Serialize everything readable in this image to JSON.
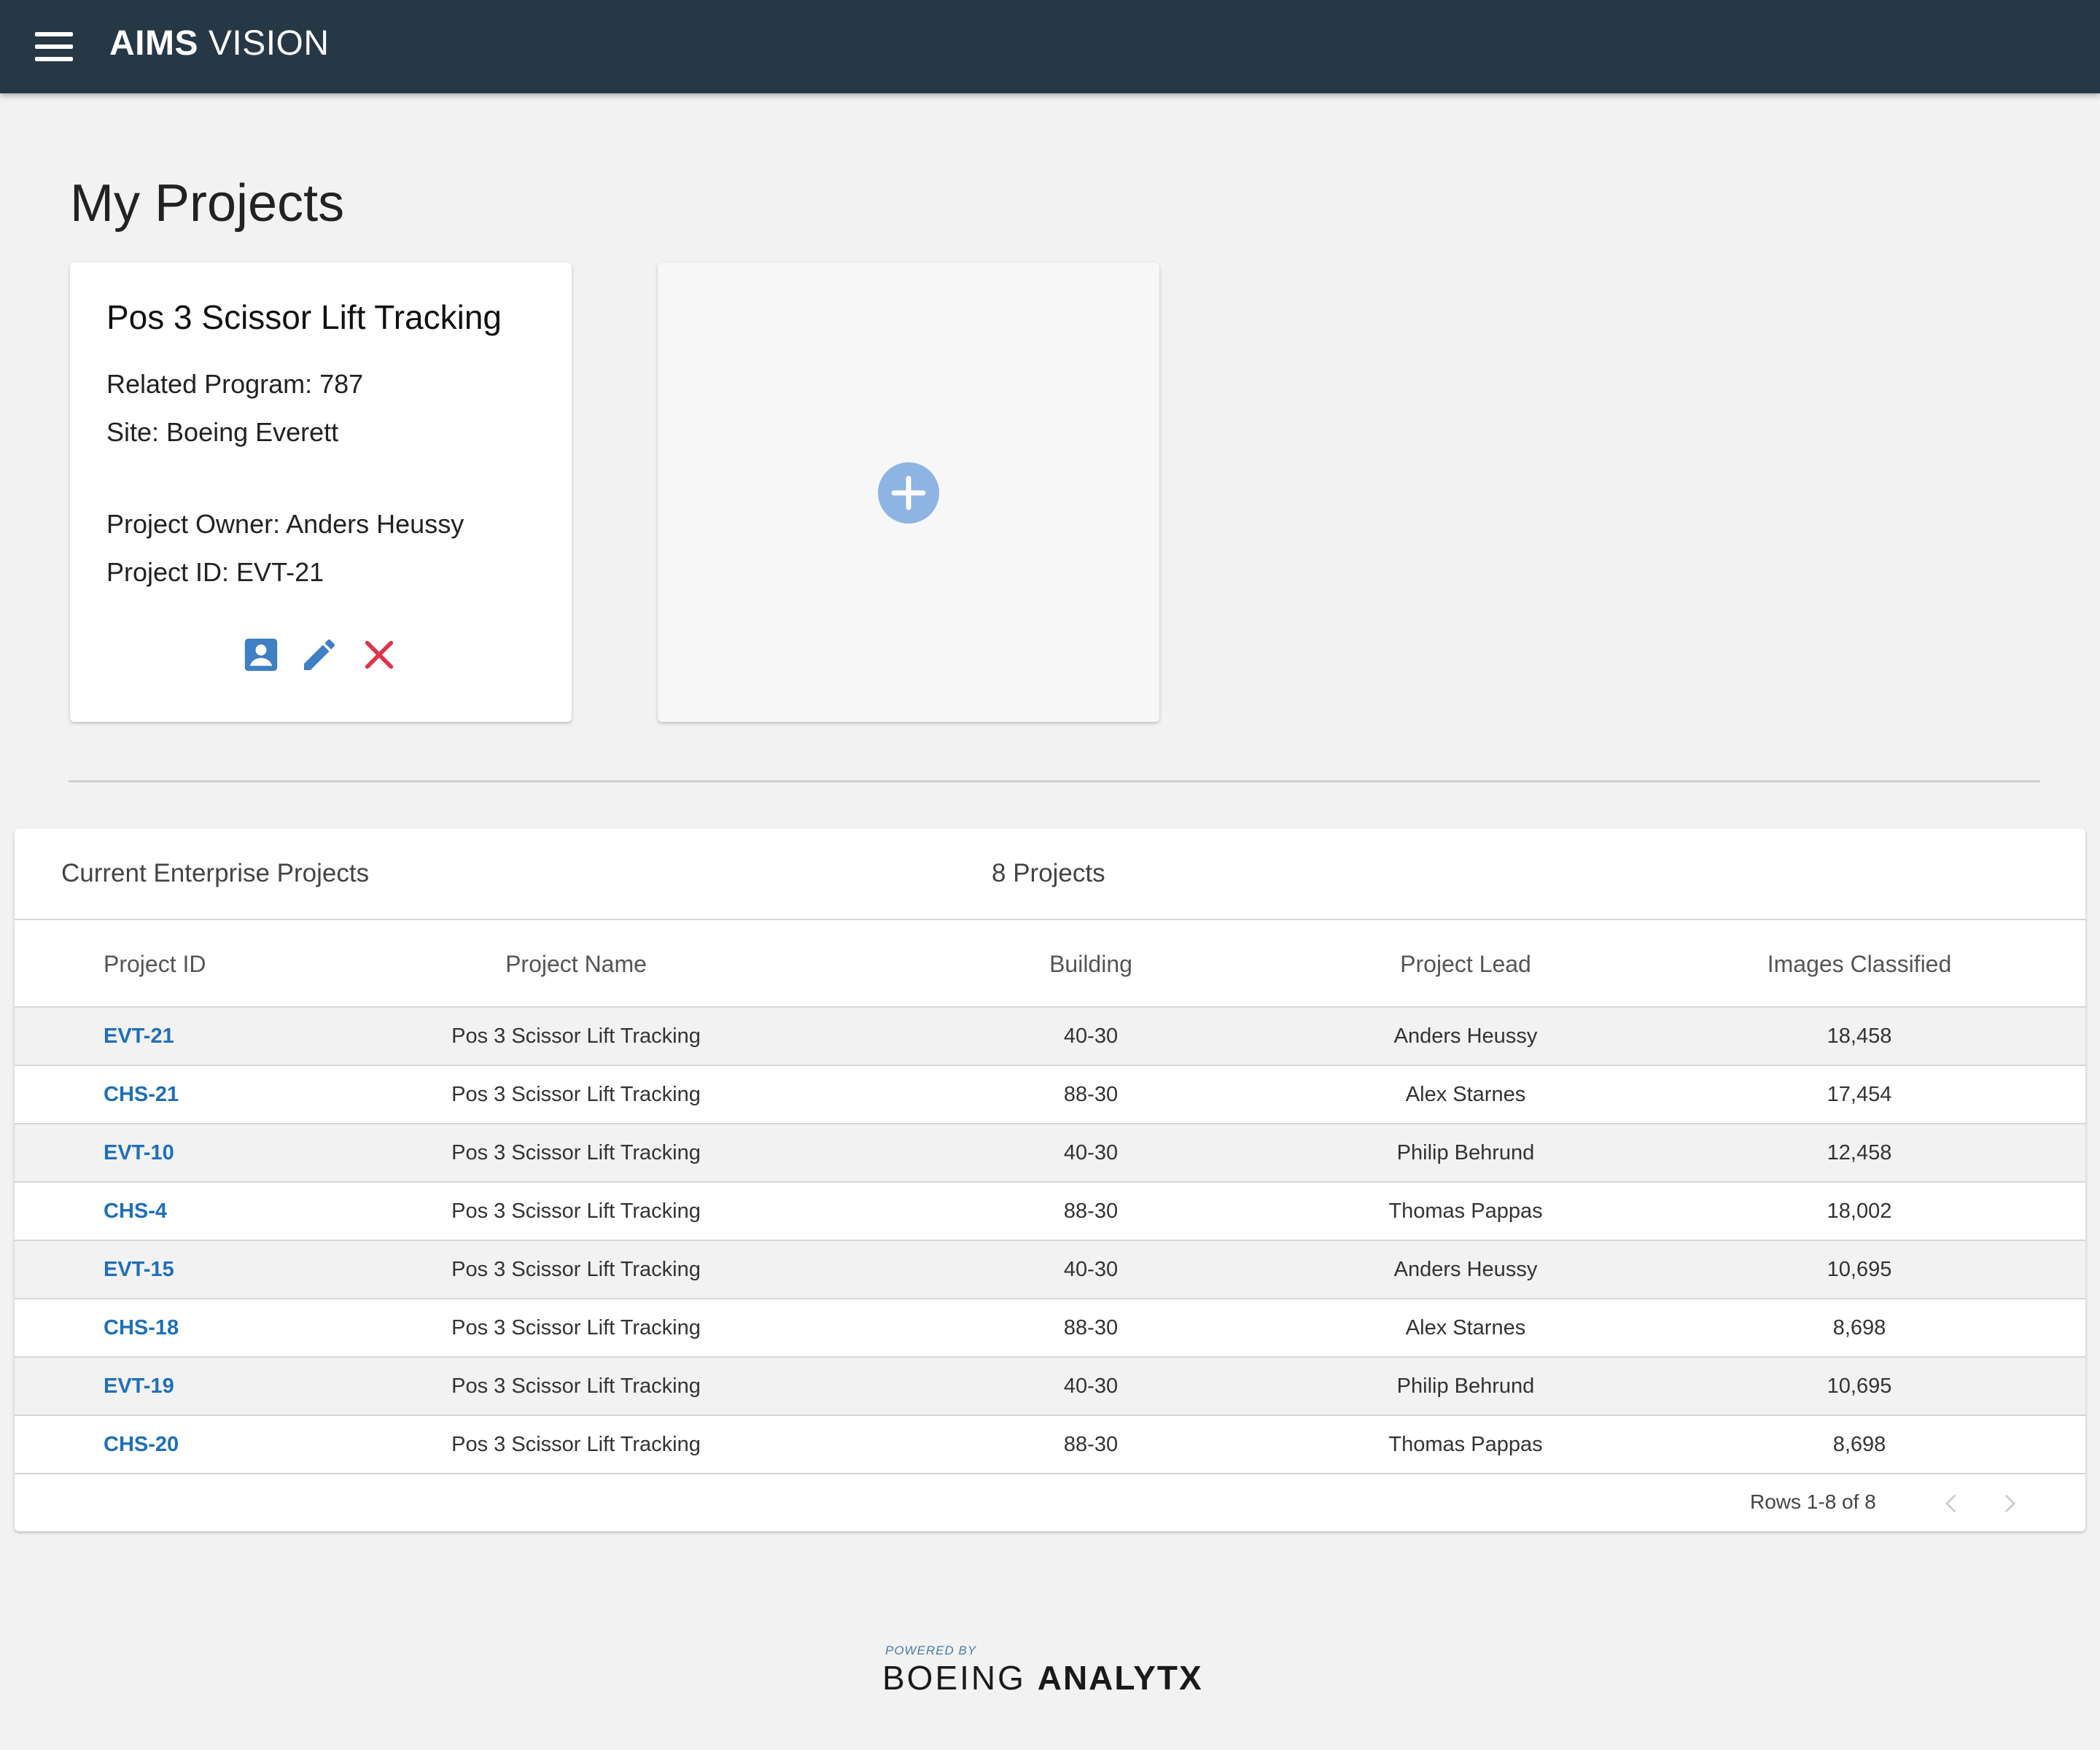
{
  "appbar": {
    "brand_bold": "AIMS",
    "brand_light": "VISION"
  },
  "page": {
    "title": "My Projects"
  },
  "project_card": {
    "title": "Pos 3 Scissor Lift Tracking",
    "related_program": "Related Program: 787",
    "site": "Site: Boeing Everett",
    "owner": "Project Owner: Anders Heussy",
    "project_id": "Project ID: EVT-21",
    "actions": [
      "account-box-icon",
      "pencil-icon",
      "close-icon"
    ],
    "colors": {
      "icon_blue": "#3f7fc4",
      "delete_red": "#e0324a"
    }
  },
  "add_card": {
    "icon": "plus-icon",
    "colors": {
      "circle": "#8db4e2"
    }
  },
  "table": {
    "title": "Current Enterprise Projects",
    "count": "8 Projects",
    "headers": {
      "id": "Project ID",
      "name": "Project Name",
      "building": "Building",
      "lead": "Project Lead",
      "images": "Images Classified"
    },
    "rows": [
      {
        "id": "EVT-21",
        "name": "Pos 3 Scissor Lift Tracking",
        "building": "40-30",
        "lead": "Anders Heussy",
        "images": "18,458"
      },
      {
        "id": "CHS-21",
        "name": "Pos 3 Scissor Lift Tracking",
        "building": "88-30",
        "lead": "Alex Starnes",
        "images": "17,454"
      },
      {
        "id": "EVT-10",
        "name": "Pos 3 Scissor Lift Tracking",
        "building": "40-30",
        "lead": "Philip Behrund",
        "images": "12,458"
      },
      {
        "id": "CHS-4",
        "name": "Pos 3 Scissor Lift Tracking",
        "building": "88-30",
        "lead": "Thomas Pappas",
        "images": "18,002"
      },
      {
        "id": "EVT-15",
        "name": "Pos 3 Scissor Lift Tracking",
        "building": "40-30",
        "lead": "Anders Heussy",
        "images": "10,695"
      },
      {
        "id": "CHS-18",
        "name": "Pos 3 Scissor Lift Tracking",
        "building": "88-30",
        "lead": "Alex Starnes",
        "images": "8,698"
      },
      {
        "id": "EVT-19",
        "name": "Pos 3 Scissor Lift Tracking",
        "building": "40-30",
        "lead": "Philip Behrund",
        "images": "10,695"
      },
      {
        "id": "CHS-20",
        "name": "Pos 3 Scissor Lift Tracking",
        "building": "88-30",
        "lead": "Thomas Pappas",
        "images": "8,698"
      }
    ],
    "pagination": {
      "info": "Rows 1-8 of 8",
      "prev_icon": "chevron-left-icon",
      "next_icon": "chevron-right-icon"
    },
    "colors": {
      "link": "#1f6fb8",
      "stripe": "#f2f2f2"
    }
  },
  "footer": {
    "powered_by": "POWERED BY",
    "brand_thin": "BOEING",
    "brand_bold": "ANALYTX"
  },
  "colors": {
    "appbar": "#263746",
    "background": "#f2f2f2"
  }
}
